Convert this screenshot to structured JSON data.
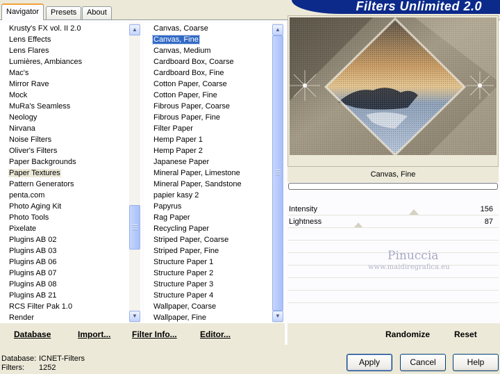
{
  "app": {
    "title": "Filters Unlimited 2.0"
  },
  "tabs": [
    {
      "label": "Navigator",
      "active": true
    },
    {
      "label": "Presets",
      "active": false
    },
    {
      "label": "About",
      "active": false
    }
  ],
  "categories": {
    "items": [
      "Krusty's FX vol. II 2.0",
      "Lens Effects",
      "Lens Flares",
      "Lumières, Ambiances",
      "Mac's",
      "Mirror Rave",
      "Mock",
      "MuRa's Seamless",
      "Neology",
      "Nirvana",
      "Noise Filters",
      "Oliver's Filters",
      "Paper Backgrounds",
      "Paper Textures",
      "Pattern Generators",
      "penta.com",
      "Photo Aging Kit",
      "Photo Tools",
      "Pixelate",
      "Plugins AB 02",
      "Plugins AB 03",
      "Plugins AB 06",
      "Plugins AB 07",
      "Plugins AB 08",
      "Plugins AB 21",
      "RCS Filter Pak 1.0",
      "Render"
    ],
    "highlighted": "Paper Textures"
  },
  "filters": {
    "items": [
      "Canvas, Coarse",
      "Canvas, Fine",
      "Canvas, Medium",
      "Cardboard Box, Coarse",
      "Cardboard Box, Fine",
      "Cotton Paper, Coarse",
      "Cotton Paper, Fine",
      "Fibrous Paper, Coarse",
      "Fibrous Paper, Fine",
      "Filter Paper",
      "Hemp Paper 1",
      "Hemp Paper 2",
      "Japanese Paper",
      "Mineral Paper, Limestone",
      "Mineral Paper, Sandstone",
      "papier kasy 2",
      "Papyrus",
      "Rag Paper",
      "Recycling Paper",
      "Striped Paper, Coarse",
      "Striped Paper, Fine",
      "Structure Paper 1",
      "Structure Paper 2",
      "Structure Paper 3",
      "Structure Paper 4",
      "Wallpaper, Coarse",
      "Wallpaper, Fine"
    ],
    "selected": "Canvas, Fine"
  },
  "left_bar": {
    "database": "Database",
    "import": "Import...",
    "filter_info": "Filter Info...",
    "editor": "Editor..."
  },
  "preview": {
    "filter_name": "Canvas, Fine"
  },
  "params": [
    {
      "label": "Intensity",
      "value": "156",
      "level": 156
    },
    {
      "label": "Lightness",
      "value": "87",
      "level": 87
    }
  ],
  "watermark": {
    "line1": "Pinuccia",
    "line2": "www.maidiregrafica.eu"
  },
  "right_bar": {
    "randomize": "Randomize",
    "reset": "Reset"
  },
  "status": {
    "database_label": "Database:",
    "database_value": "ICNET-Filters",
    "filters_label": "Filters:",
    "filters_value": "1252"
  },
  "buttons": {
    "apply": "Apply",
    "cancel": "Cancel",
    "help": "Help"
  },
  "colors": {
    "selection": "#316ac5",
    "banner": "#0c2a8a",
    "dialog_bg": "#ece9d8"
  }
}
